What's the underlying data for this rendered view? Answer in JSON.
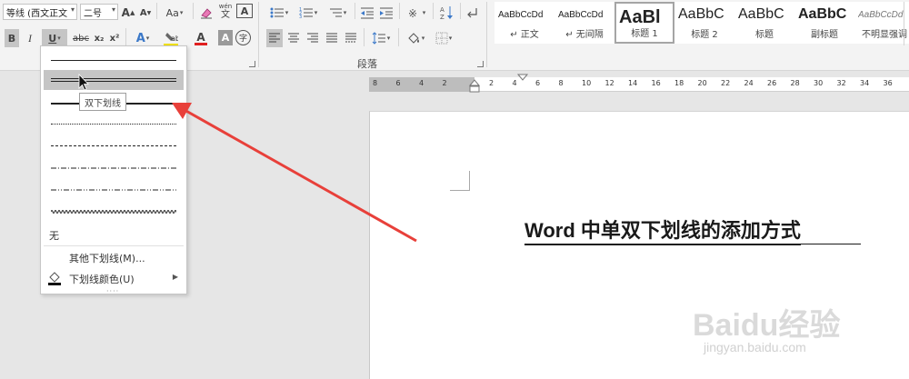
{
  "ribbon": {
    "font_name": "等线 (西文正文",
    "font_size": "二号",
    "grow_font": "A",
    "shrink_font": "A",
    "change_case": "Aa",
    "phonetic_guide": "wén",
    "char_border": "A",
    "bold": "B",
    "italic": "I",
    "underline": "U",
    "strikethrough": "abc",
    "subscript": "x₂",
    "superscript": "x²",
    "text_effects": "A",
    "font_color": "A",
    "char_shading": "A",
    "enclose_char": "字",
    "sort": "A↓Z",
    "paragraph_label": "段落"
  },
  "styles": [
    {
      "sample": "AaBbCcDd",
      "name": "↵ 正文",
      "selected": false
    },
    {
      "sample": "AaBbCcDd",
      "name": "↵ 无间隔",
      "selected": false
    },
    {
      "sample": "AaBl",
      "name": "标题 1",
      "selected": true
    },
    {
      "sample": "AaBbC",
      "name": "标题 2",
      "selected": false
    },
    {
      "sample": "AaBbC",
      "name": "标题",
      "selected": false
    },
    {
      "sample": "AaBbC",
      "name": "副标题",
      "selected": false
    },
    {
      "sample": "AaBbCcDd",
      "name": "不明显强调",
      "selected": false
    }
  ],
  "underline_menu": {
    "styles": [
      "single",
      "double",
      "thick",
      "dotted",
      "dashed",
      "dash-dot",
      "dash-dot-dot",
      "wavy"
    ],
    "none_label": "无",
    "more_underlines": "其他下划线(M)...",
    "underline_color": "下划线颜色(U)",
    "tooltip": "双下划线",
    "hovered": "double"
  },
  "ruler": {
    "ticks_left": [
      "8",
      "6",
      "4",
      "2"
    ],
    "ticks_right": [
      "2",
      "4",
      "6",
      "8",
      "10",
      "12",
      "14",
      "16",
      "18",
      "20",
      "22",
      "24",
      "26",
      "28",
      "30",
      "32",
      "34",
      "36"
    ]
  },
  "document": {
    "title": "Word 中单双下划线的添加方式"
  },
  "watermark": {
    "logo": "Baidu经验",
    "url": "jingyan.baidu.com"
  },
  "colors": {
    "annotation_arrow": "#e8403a",
    "font_color_bar": "#e02020",
    "highlight_bar": "#f0e000"
  }
}
